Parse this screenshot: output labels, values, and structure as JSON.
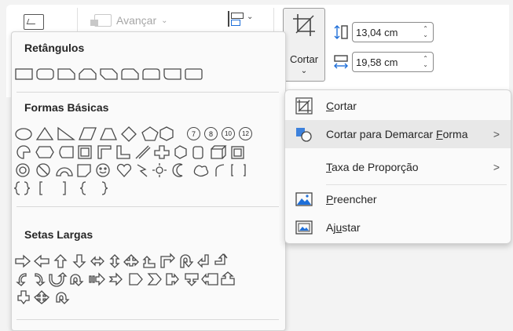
{
  "ribbon": {
    "avancar_label": "Avançar",
    "crop_label": "Cortar",
    "height_value": "13,04 cm",
    "width_value": "19,58 cm"
  },
  "shapes_gallery": {
    "sections": [
      {
        "title": "Retângulos"
      },
      {
        "title": "Formas Básicas"
      },
      {
        "title": "Setas Largas"
      }
    ],
    "basic_number_shapes": [
      "7",
      "8",
      "10",
      "12"
    ]
  },
  "crop_menu": {
    "items": [
      {
        "pre": "",
        "key": "C",
        "post": "ortar",
        "has_submenu": false
      },
      {
        "pre": "Cortar para Demarcar ",
        "key": "F",
        "post": "orma",
        "has_submenu": true
      },
      {
        "pre": "",
        "key": "T",
        "post": "axa de Proporção",
        "has_submenu": true
      },
      {
        "pre": "",
        "key": "P",
        "post": "reencher",
        "has_submenu": false
      },
      {
        "pre": "Aj",
        "key": "u",
        "post": "star",
        "has_submenu": false
      }
    ],
    "submenu_arrow": ">"
  },
  "colors": {
    "accent": "#1e6fd9",
    "shape_stroke": "#4a4a4a",
    "hover": "#e8e8e8"
  }
}
